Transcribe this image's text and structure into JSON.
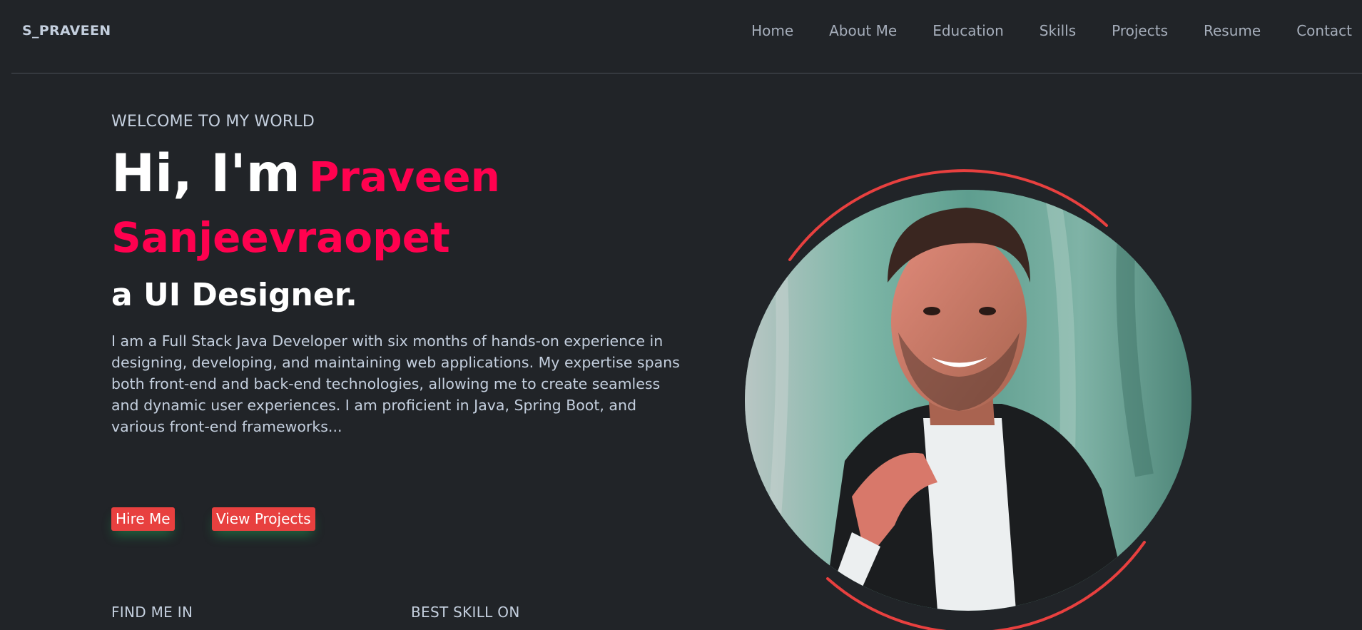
{
  "header": {
    "logo": "S_PRAVEEN",
    "nav": [
      {
        "label": "Home"
      },
      {
        "label": "About Me"
      },
      {
        "label": "Education"
      },
      {
        "label": "Skills"
      },
      {
        "label": "Projects"
      },
      {
        "label": "Resume"
      },
      {
        "label": "Contact"
      }
    ]
  },
  "hero": {
    "welcome": "WELCOME TO MY WORLD",
    "greeting": "Hi, I'm",
    "name": "Praveen Sanjeevraopet",
    "role": "a UI Designer.",
    "bio": "I am a Full Stack Java Developer with six months of hands-on experience in designing, developing, and maintaining web applications. My expertise spans both front-end and back-end technologies, allowing me to create seamless and dynamic user experiences. I am proficient in Java, Spring Boot, and various front-end frameworks...",
    "buttons": {
      "hire": "Hire Me",
      "projects": "View Projects"
    },
    "find_me": "FIND ME IN",
    "best_skill": "BEST SKILL ON"
  },
  "colors": {
    "background": "#212428",
    "accent_name": "#ff014f",
    "button": "#e8403f",
    "ring": "#e8403f"
  },
  "icons": {
    "portrait": "profile-photo"
  }
}
